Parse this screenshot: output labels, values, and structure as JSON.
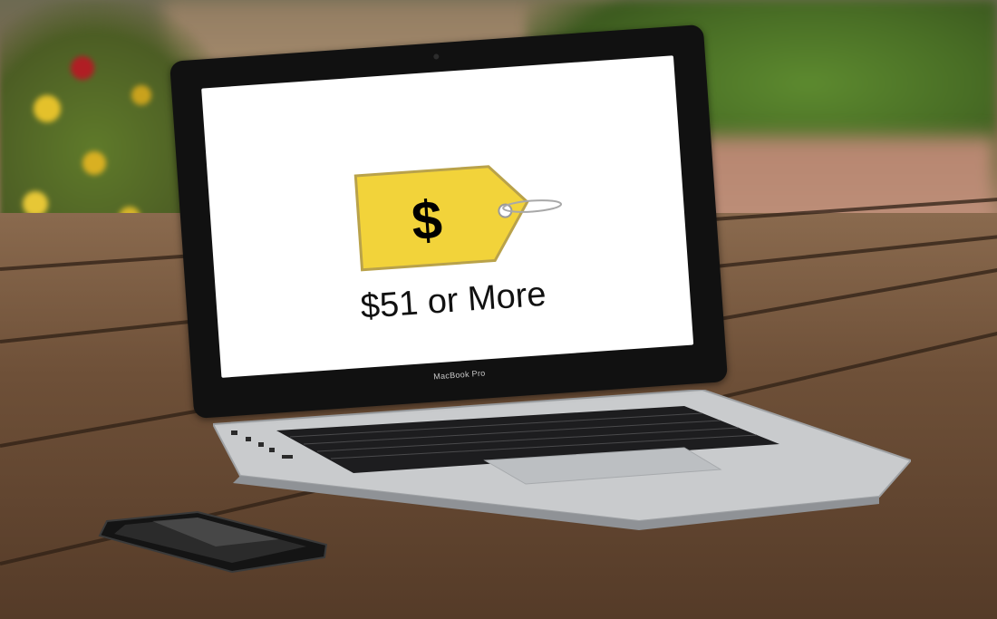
{
  "screen": {
    "tag_symbol": "$",
    "caption": "$51 or More"
  },
  "laptop": {
    "brand_label": "MacBook Pro"
  },
  "colors": {
    "tag_yellow": "#f2d33a",
    "tag_border": "#b9a24a",
    "screen_bg": "#ffffff",
    "caption_text": "#111111",
    "lid_frame": "#111111",
    "aluminum": "#c9cbcd"
  }
}
